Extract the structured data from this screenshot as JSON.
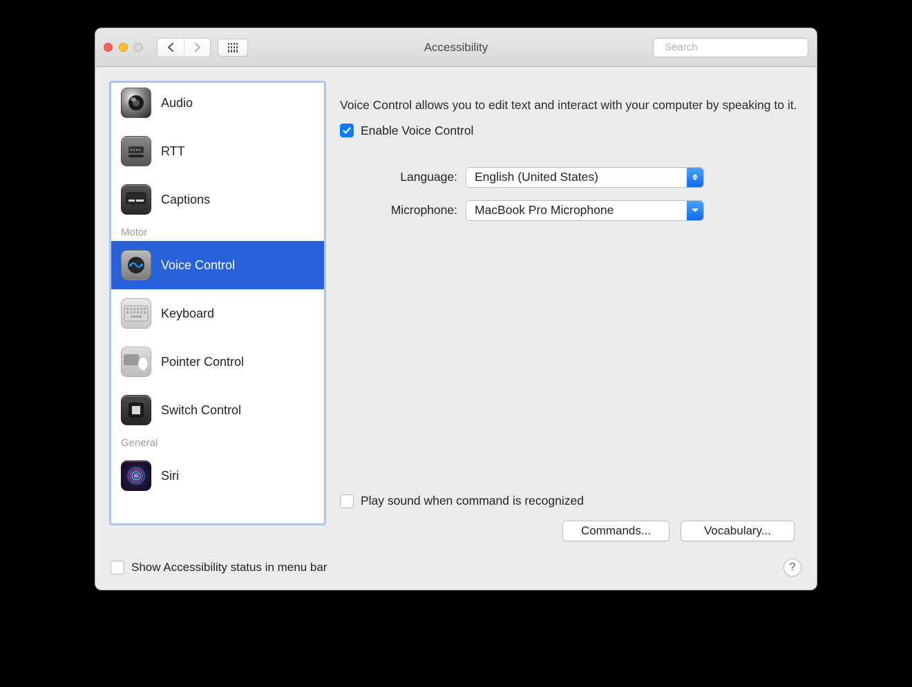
{
  "window": {
    "title": "Accessibility"
  },
  "toolbar": {
    "search_placeholder": "Search"
  },
  "sidebar": {
    "items": [
      {
        "label": "Audio"
      },
      {
        "label": "RTT"
      },
      {
        "label": "Captions"
      }
    ],
    "heading_motor": "Motor",
    "motor_items": [
      {
        "label": "Voice Control",
        "selected": true
      },
      {
        "label": "Keyboard"
      },
      {
        "label": "Pointer Control"
      },
      {
        "label": "Switch Control"
      }
    ],
    "heading_general": "General",
    "general_items": [
      {
        "label": "Siri"
      }
    ]
  },
  "content": {
    "description": "Voice Control allows you to edit text and interact with your computer by speaking to it.",
    "enable_label": "Enable Voice Control",
    "enable_checked": true,
    "language_label": "Language:",
    "language_value": "English (United States)",
    "microphone_label": "Microphone:",
    "microphone_value": "MacBook Pro Microphone",
    "play_sound_label": "Play sound when command is recognized",
    "play_sound_checked": false,
    "commands_button": "Commands...",
    "vocabulary_button": "Vocabulary..."
  },
  "footer": {
    "status_checkbox_label": "Show Accessibility status in menu bar",
    "status_checkbox_checked": false
  }
}
